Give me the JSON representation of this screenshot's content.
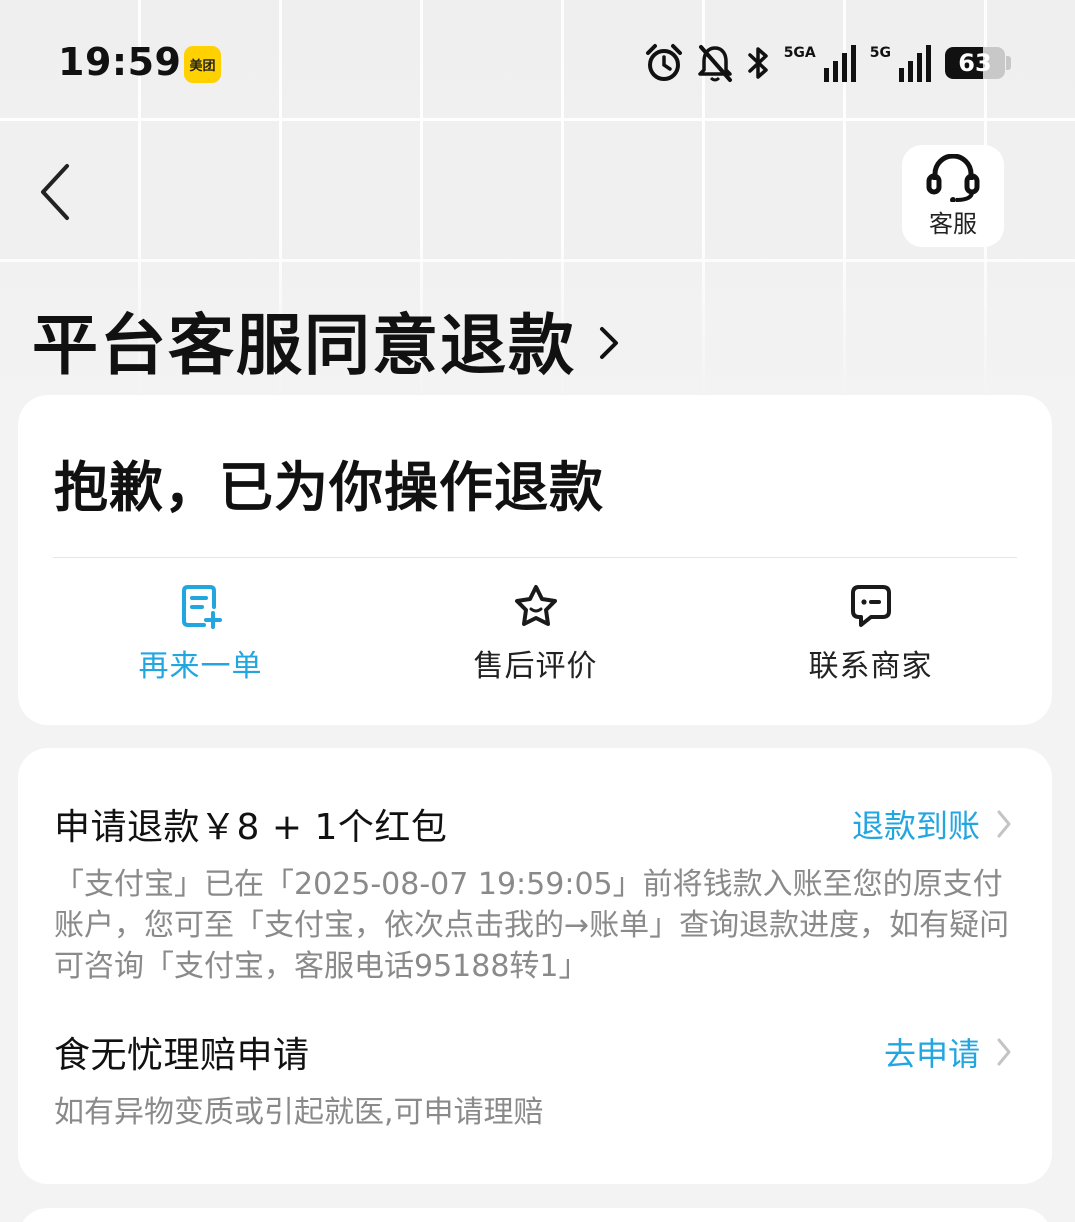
{
  "status_bar": {
    "time": "19:59",
    "app_badge": "美团",
    "signal1_label": "5GA",
    "signal2_label": "5G",
    "battery_percent": "63",
    "battery_level": 0.63
  },
  "header": {
    "service_label": "客服",
    "page_title": "平台客服同意退款"
  },
  "status_card": {
    "message": "抱歉，已为你操作退款",
    "actions": [
      {
        "label": "再来一单",
        "icon": "reorder-icon"
      },
      {
        "label": "售后评价",
        "icon": "star-icon"
      },
      {
        "label": "联系商家",
        "icon": "chat-icon"
      }
    ]
  },
  "refund_card": {
    "refund": {
      "title": "申请退款￥8 + 1个红包",
      "link": "退款到账",
      "description": "「支付宝」已在「2025-08-07 19:59:05」前将钱款入账至您的原支付账户，您可至「支付宝，依次点击我的→账单」查询退款进度，如有疑问可咨询「支付宝，客服电话95188转1」"
    },
    "claim": {
      "title": "食无忧理赔申请",
      "link": "去申请",
      "description": "如有异物变质或引起就医,可申请理赔"
    }
  },
  "colors": {
    "accent": "#22a6e0",
    "page_bg": "#f3f3f3",
    "badge": "#ffd100"
  }
}
